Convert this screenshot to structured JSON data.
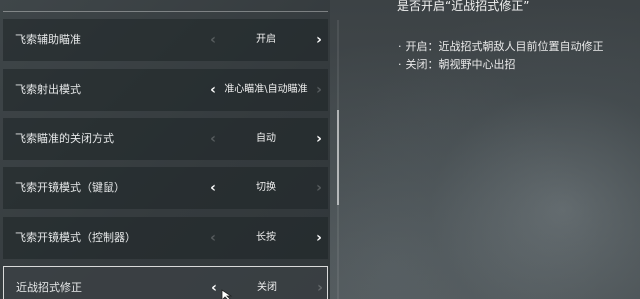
{
  "settings": {
    "rows": [
      {
        "label": "飞索辅助瞄准",
        "value": "开启",
        "left_enabled": false,
        "right_enabled": true
      },
      {
        "label": "飞索射出模式",
        "value": "准心瞄准\\自动瞄准",
        "left_enabled": true,
        "right_enabled": false
      },
      {
        "label": "飞索瞄准的关闭方式",
        "value": "自动",
        "left_enabled": false,
        "right_enabled": true
      },
      {
        "label": "飞索开镜模式（键鼠）",
        "value": "切换",
        "left_enabled": true,
        "right_enabled": false
      },
      {
        "label": "飞索开镜模式（控制器）",
        "value": "长按",
        "left_enabled": false,
        "right_enabled": true
      },
      {
        "label": "近战招式修正",
        "value": "关闭",
        "left_enabled": true,
        "right_enabled": false,
        "selected": true
      }
    ],
    "arrow_left_glyph": "‹",
    "arrow_right_glyph": "›"
  },
  "description": {
    "title": "是否开启“近战招式修正”",
    "bullet_glyph": "·",
    "lines": [
      "开启：近战招式朝敌人目前位置自动修正",
      "关闭：朝视野中心出招"
    ]
  },
  "icons": {
    "cursor": "mouse-pointer-icon"
  },
  "colors": {
    "row_background": "#1e2427",
    "selected_border": "#ebebeb",
    "text": "#e6e8e9"
  }
}
